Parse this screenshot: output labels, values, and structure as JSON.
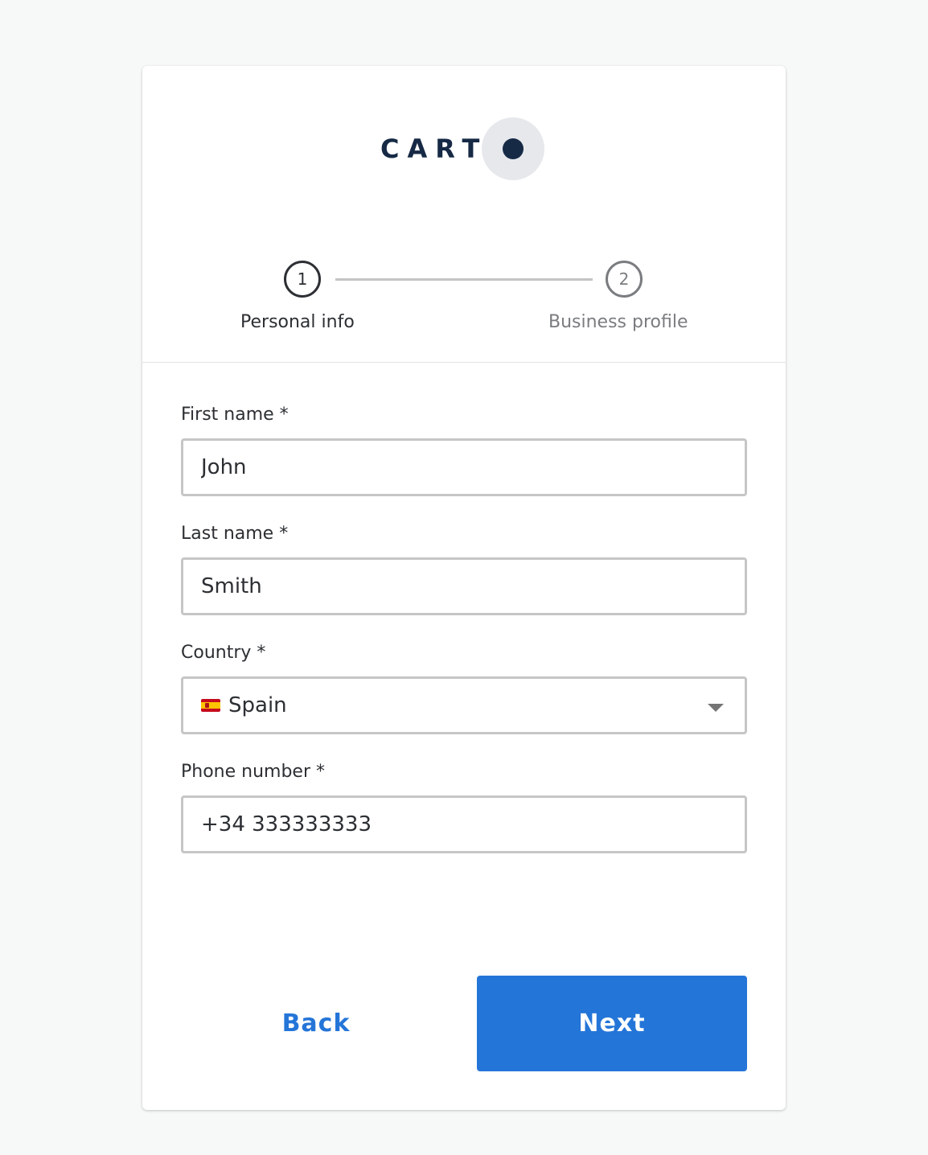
{
  "brand": {
    "logo_text": "CART"
  },
  "stepper": {
    "steps": [
      {
        "number": "1",
        "label": "Personal info",
        "state": "active"
      },
      {
        "number": "2",
        "label": "Business profile",
        "state": "inactive"
      }
    ]
  },
  "form": {
    "first_name": {
      "label": "First name *",
      "value": "John"
    },
    "last_name": {
      "label": "Last name *",
      "value": "Smith"
    },
    "country": {
      "label": "Country *",
      "value": "Spain",
      "flag_icon": "spain-flag-icon"
    },
    "phone": {
      "label": "Phone number *",
      "value": "+34 333333333"
    }
  },
  "actions": {
    "back_label": "Back",
    "next_label": "Next"
  },
  "colors": {
    "accent": "#2475d8",
    "brand_navy": "#162945",
    "background": "#f7f8f8"
  }
}
